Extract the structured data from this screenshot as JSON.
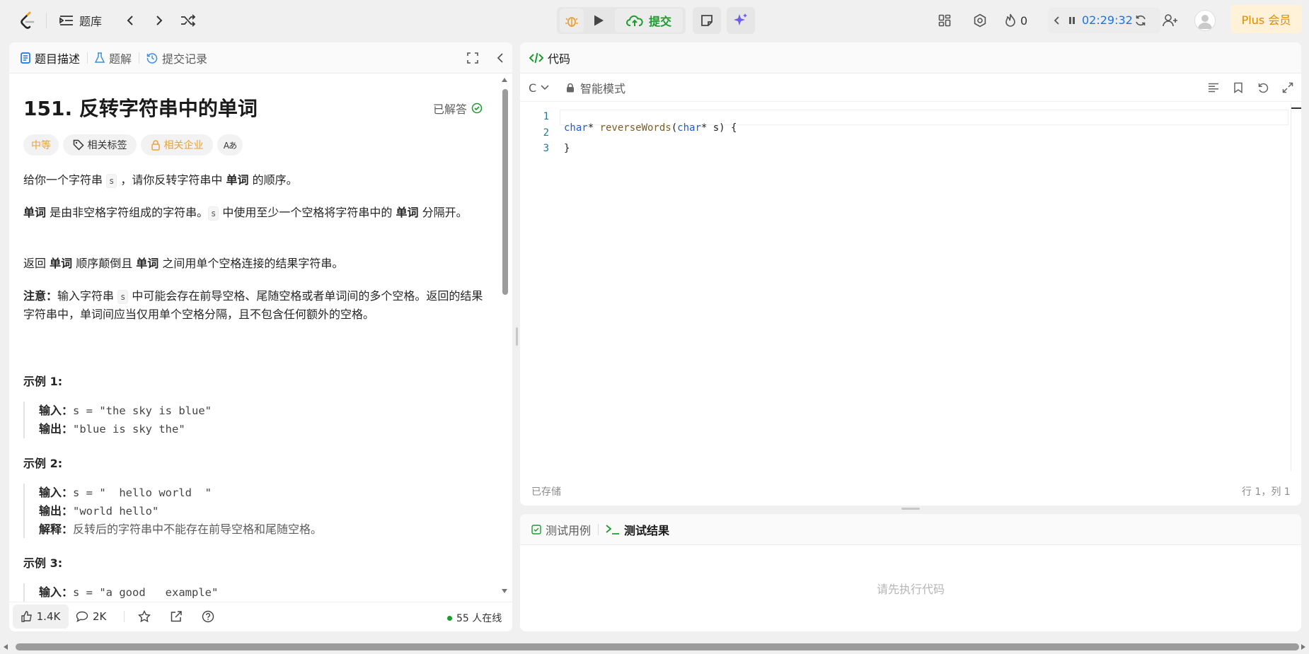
{
  "colors": {
    "accent": "#1a9c2f",
    "orange": "#e6a23c",
    "blue": "#1a73e8",
    "plus_bg": "#fff2d8",
    "plus_text": "#e08a00"
  },
  "topbar": {
    "problem_list_label": "题库",
    "submit_label": "提交",
    "streak_count": "0",
    "timer": "02:29:32",
    "plus_label": "Plus 会员"
  },
  "left": {
    "tabs": [
      "题目描述",
      "题解",
      "提交记录"
    ],
    "title": "151. 反转字符串中的单词",
    "solved_label": "已解答",
    "chips": {
      "difficulty": "中等",
      "tags": "相关标签",
      "companies": "相关企业",
      "font": "Aあ"
    },
    "para1": {
      "a": "给你一个字符串 ",
      "code": "s",
      "b": " ，请你反转字符串中 ",
      "bold": "单词",
      "c": " 的顺序。"
    },
    "para2": {
      "bold1": "单词",
      "a": " 是由非空格字符组成的字符串。",
      "code": "s",
      "b": " 中使用至少一个空格将字符串中的 ",
      "bold2": "单词",
      "c": " 分隔开。"
    },
    "para3": {
      "a": "返回 ",
      "bold1": "单词",
      "b": " 顺序颠倒且 ",
      "bold2": "单词",
      "c": " 之间用单个空格连接的结果字符串。"
    },
    "para4": {
      "bold": "注意：",
      "a": "输入字符串 ",
      "code": "s",
      "b": " 中可能会存在前导空格、尾随空格或者单词间的多个空格。返回的结果字符串中，单词间应当仅用单个空格分隔，且不包含任何额外的空格。"
    },
    "examples": [
      {
        "title": "示例 1:",
        "input_label": "输入：",
        "input": "s = \"the sky is blue\"",
        "output_label": "输出：",
        "output": "\"blue is sky the\""
      },
      {
        "title": "示例 2:",
        "input_label": "输入：",
        "input": "s = \"  hello world  \"",
        "output_label": "输出：",
        "output": "\"world hello\"",
        "explain_label": "解释：",
        "explain": "反转后的字符串中不能存在前导空格和尾随空格。"
      },
      {
        "title": "示例 3:",
        "input_label": "输入：",
        "input": "s = \"a good   example\""
      }
    ],
    "footer": {
      "likes": "1.4K",
      "comments": "2K",
      "online": "55 人在线"
    }
  },
  "editor": {
    "tab_label": "代码",
    "language": "C",
    "mode_label": "智能模式",
    "lines": [
      {
        "num": "1",
        "kw1": "char",
        "t1": "* ",
        "fn": "reverseWords",
        "t2": "(",
        "kw2": "char",
        "t3": "* s) {"
      },
      {
        "num": "2"
      },
      {
        "num": "3",
        "text": "}"
      }
    ],
    "saved_label": "已存储",
    "cursor_pos": "行 1，列 1"
  },
  "console": {
    "tabs": [
      "测试用例",
      "测试结果"
    ],
    "placeholder": "请先执行代码"
  }
}
